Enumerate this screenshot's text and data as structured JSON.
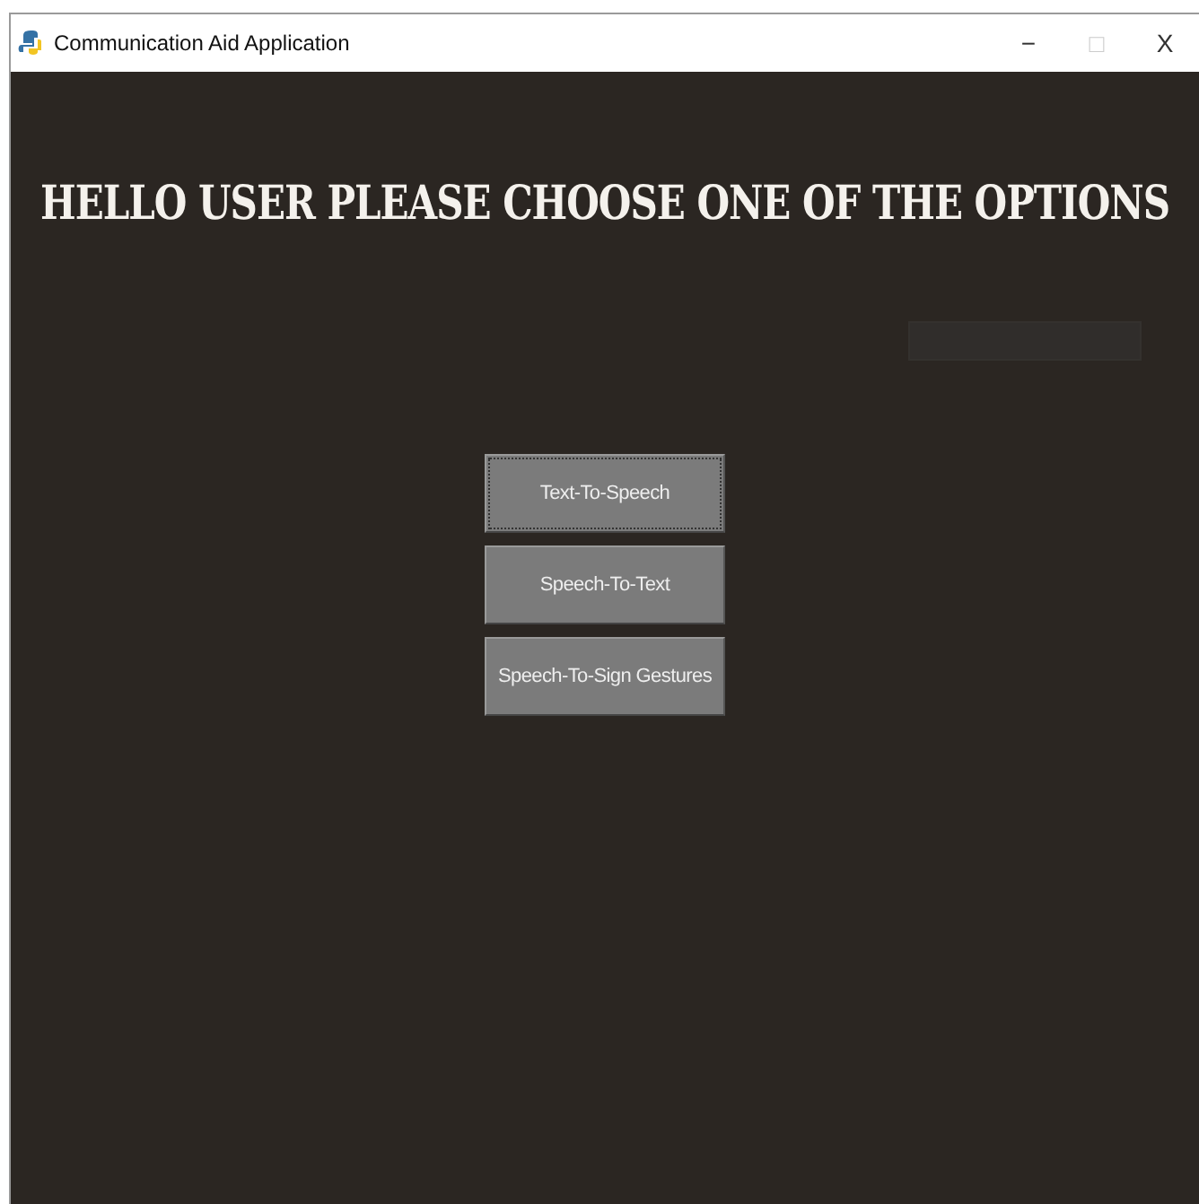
{
  "window": {
    "title": "Communication Aid Application",
    "controls": [
      "−",
      "□",
      "X"
    ]
  },
  "heading": "HELLO USER PLEASE CHOOSE ONE OF THE OPTIONS",
  "buttons": [
    {
      "label": "Text-To-Speech",
      "focused": true
    },
    {
      "label": "Speech-To-Text",
      "focused": false
    },
    {
      "label": "Speech-To-Sign Gestures",
      "focused": false
    }
  ]
}
